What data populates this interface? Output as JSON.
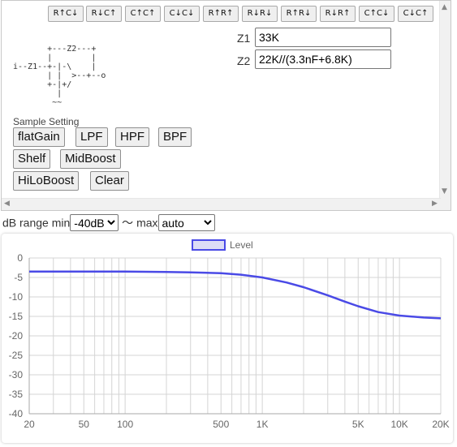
{
  "topbar": {
    "buttons": [
      {
        "label": "R↑C↓"
      },
      {
        "label": "R↓C↑"
      },
      {
        "label": "C↑C↑"
      },
      {
        "label": "C↓C↓"
      },
      {
        "label": "R↑R↑"
      },
      {
        "label": "R↓R↓"
      },
      {
        "label": "R↑R↓"
      },
      {
        "label": "R↓R↑"
      },
      {
        "label": "C↑C↓"
      },
      {
        "label": "C↓C↑"
      }
    ]
  },
  "impedance": {
    "z1_label": "Z1",
    "z1_value": "33K",
    "z2_label": "Z2",
    "z2_value": "22K//(3.3nF+6.8K)"
  },
  "circuit_diagram": "       +---Z2---+\n       |        |\ni--Z1--+-|-\\    |\n       | |  >--+--o\n       +-|+/\n         |\n        ~~",
  "samples": {
    "label": "Sample Setting",
    "buttons": {
      "flatgain": "flatGain",
      "lpf": "LPF",
      "hpf": "HPF",
      "bpf": "BPF",
      "shelf": "Shelf",
      "midboost": "MidBoost",
      "hiloboost": "HiLoBoost",
      "clear": "Clear"
    }
  },
  "range": {
    "prefix": "dB range min",
    "min_value": "-40dB",
    "separator": "〜",
    "max_label": "max",
    "max_value": "auto"
  },
  "scroll_icons": {
    "up": "▲",
    "down": "▼",
    "left": "◀",
    "right": "▶"
  },
  "chart_data": {
    "type": "line",
    "legend": [
      "Level"
    ],
    "legend_position": "top-center",
    "xscale": "log",
    "xlim": [
      20,
      20000
    ],
    "ylim": [
      -40,
      0
    ],
    "grid": true,
    "xticks": [
      {
        "v": 20,
        "label": "20"
      },
      {
        "v": 50,
        "label": "50"
      },
      {
        "v": 100,
        "label": "100"
      },
      {
        "v": 500,
        "label": "500"
      },
      {
        "v": 1000,
        "label": "1K"
      },
      {
        "v": 5000,
        "label": "5K"
      },
      {
        "v": 10000,
        "label": "10K"
      },
      {
        "v": 20000,
        "label": "20K"
      }
    ],
    "yticks": [
      0,
      -5,
      -10,
      -15,
      -20,
      -25,
      -30,
      -35,
      -40
    ],
    "series": [
      {
        "name": "Level",
        "color": "#4a4ae6",
        "x": [
          20,
          50,
          100,
          200,
          300,
          500,
          700,
          1000,
          1500,
          2000,
          3000,
          4000,
          5000,
          7000,
          10000,
          15000,
          20000
        ],
        "y": [
          -3.5,
          -3.5,
          -3.5,
          -3.6,
          -3.7,
          -3.9,
          -4.3,
          -5.0,
          -6.3,
          -7.5,
          -9.6,
          -11.2,
          -12.4,
          -13.9,
          -14.8,
          -15.3,
          -15.5
        ]
      }
    ]
  }
}
